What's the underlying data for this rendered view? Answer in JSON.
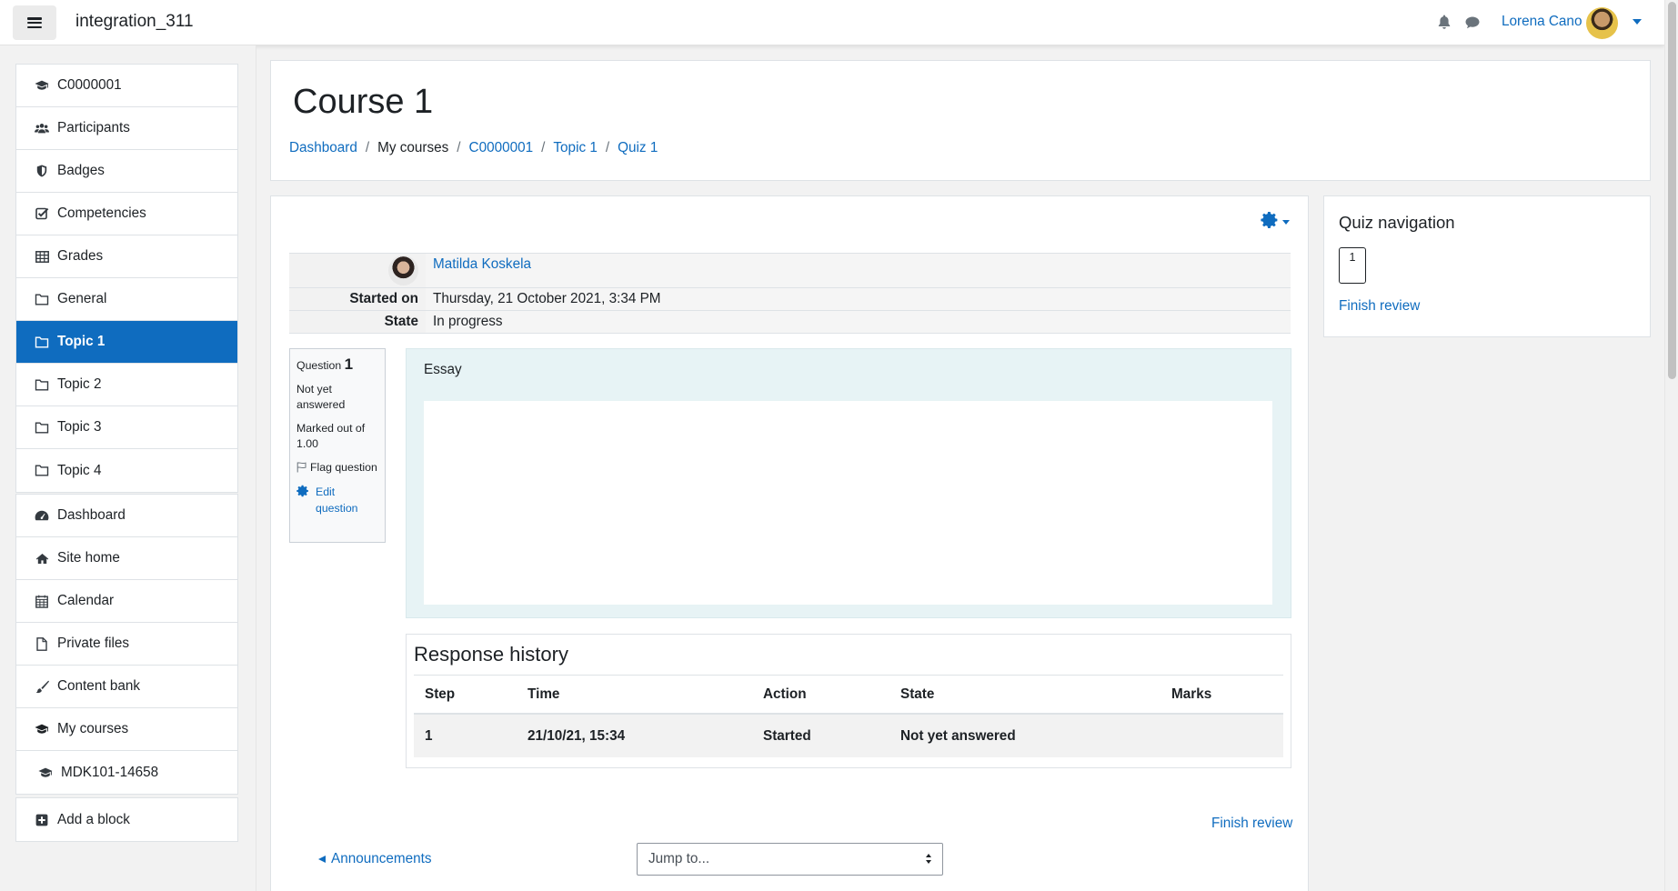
{
  "navbar": {
    "site_name": "integration_311",
    "user_name": "Lorena Cano",
    "icons": [
      "hamburger-icon",
      "bell-icon",
      "chat-icon"
    ]
  },
  "drawer": {
    "course_items": [
      {
        "label": "C0000001",
        "icon": "graduation-cap-icon"
      },
      {
        "label": "Participants",
        "icon": "users-icon"
      },
      {
        "label": "Badges",
        "icon": "shield-icon"
      },
      {
        "label": "Competencies",
        "icon": "check-square-icon"
      },
      {
        "label": "Grades",
        "icon": "table-icon"
      },
      {
        "label": "General",
        "icon": "folder-icon"
      },
      {
        "label": "Topic 1",
        "icon": "folder-icon",
        "active": true
      },
      {
        "label": "Topic 2",
        "icon": "folder-icon"
      },
      {
        "label": "Topic 3",
        "icon": "folder-icon"
      },
      {
        "label": "Topic 4",
        "icon": "folder-icon"
      }
    ],
    "site_items": [
      {
        "label": "Dashboard",
        "icon": "dashboard-icon"
      },
      {
        "label": "Site home",
        "icon": "home-icon"
      },
      {
        "label": "Calendar",
        "icon": "calendar-icon"
      },
      {
        "label": "Private files",
        "icon": "file-icon"
      },
      {
        "label": "Content bank",
        "icon": "brush-icon"
      },
      {
        "label": "My courses",
        "icon": "graduation-cap-icon"
      },
      {
        "label": "MDK101-14658",
        "icon": "graduation-cap-icon"
      }
    ],
    "add_block": {
      "label": "Add a block",
      "icon": "plus-square-icon"
    }
  },
  "header": {
    "title": "Course 1",
    "breadcrumb": [
      "Dashboard",
      "My courses",
      "C0000001",
      "Topic 1",
      "Quiz 1"
    ]
  },
  "summary": {
    "student_name": "Matilda Koskela",
    "started_on_label": "Started on",
    "started_on_value": "Thursday, 21 October 2021, 3:34 PM",
    "state_label": "State",
    "state_value": "In progress"
  },
  "question": {
    "number_label": "Question",
    "number": "1",
    "status": "Not yet answered",
    "marked_out_of": "Marked out of 1.00",
    "flag_label": "Flag question",
    "edit_label": "Edit question",
    "text": "Essay"
  },
  "history": {
    "title": "Response history",
    "columns": [
      "Step",
      "Time",
      "Action",
      "State",
      "Marks"
    ],
    "rows": [
      {
        "step": "1",
        "time": "21/10/21, 15:34",
        "action": "Started",
        "state": "Not yet answered",
        "marks": ""
      }
    ]
  },
  "footer": {
    "finish_review": "Finish review",
    "prev_link": "Announcements",
    "jump_to": "Jump to..."
  },
  "quiz_nav": {
    "title": "Quiz navigation",
    "buttons": [
      "1"
    ],
    "finish_review": "Finish review"
  },
  "colors": {
    "accent": "#0f6cbf",
    "formulation_bg": "#e7f3f5",
    "page_bg": "#f2f2f2"
  }
}
